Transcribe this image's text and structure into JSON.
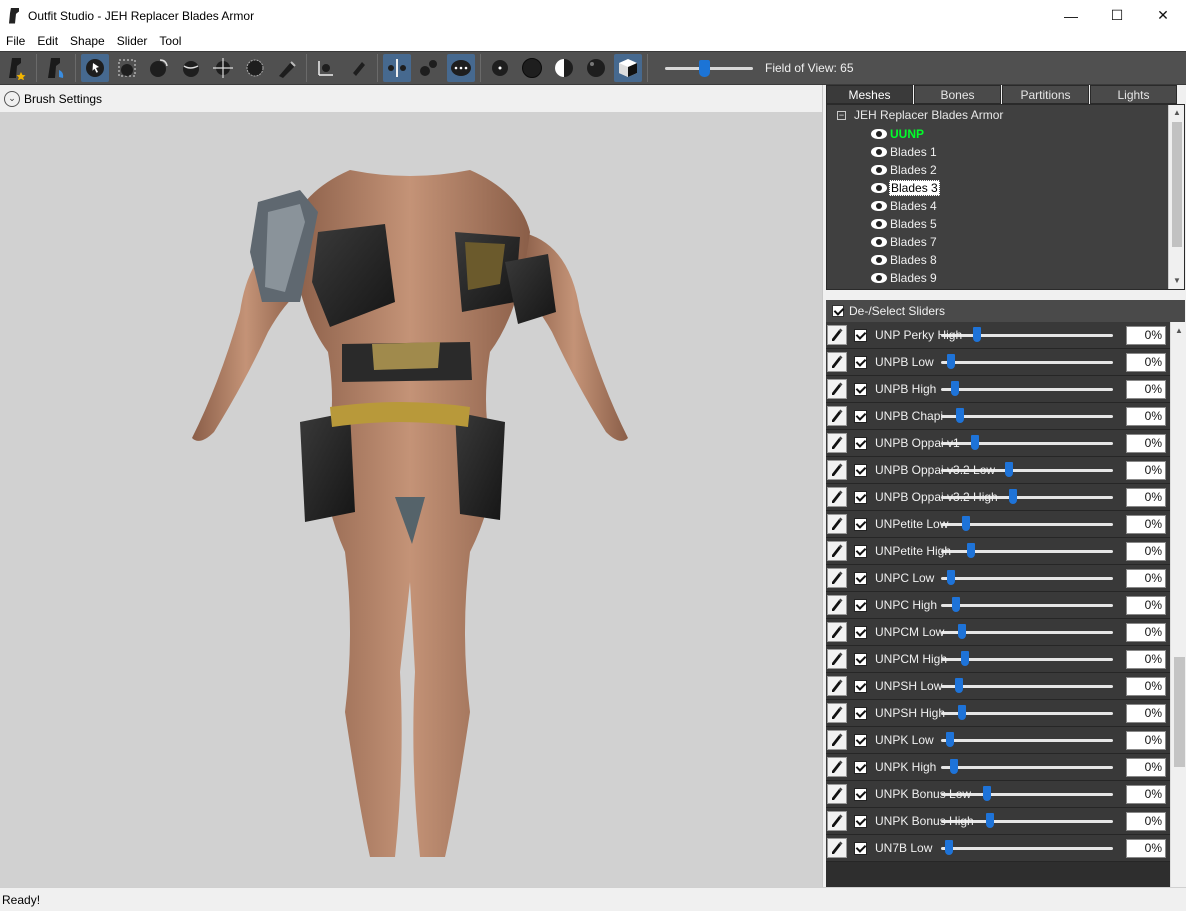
{
  "window": {
    "title": "Outfit Studio - JEH Replacer Blades Armor",
    "controls": [
      "—",
      "☐",
      "✕"
    ]
  },
  "menu": [
    "File",
    "Edit",
    "Shape",
    "Slider",
    "Tool"
  ],
  "toolbar": {
    "field_of_view_label": "Field of View: 65",
    "field_of_view_value": 65,
    "accent_color": "#1c74d6"
  },
  "brush_settings": {
    "label": "Brush Settings"
  },
  "panel": {
    "tabs": [
      "Meshes",
      "Bones",
      "Partitions",
      "Lights"
    ],
    "active_tab": "Meshes",
    "tree": {
      "root": "JEH Replacer Blades Armor",
      "items": [
        {
          "label": "UUNP",
          "reference": true
        },
        {
          "label": "Blades 1"
        },
        {
          "label": "Blades 2"
        },
        {
          "label": "Blades 3",
          "selected": true
        },
        {
          "label": "Blades 4"
        },
        {
          "label": "Blades 5"
        },
        {
          "label": "Blades 7"
        },
        {
          "label": "Blades 8"
        },
        {
          "label": "Blades 9"
        }
      ]
    },
    "slider_header": "De-/Select Sliders",
    "sliders": [
      {
        "name": "UNP Perky High",
        "level": 0.0,
        "value": "0%"
      },
      {
        "name": "UNPB Low",
        "level": 0.0,
        "value": "0%"
      },
      {
        "name": "UNPB High",
        "level": 0.0,
        "value": "0%"
      },
      {
        "name": "UNPB Chapi",
        "level": 0.0,
        "value": "0%"
      },
      {
        "name": "UNPB Oppai v1",
        "level": 0.0,
        "value": "0%"
      },
      {
        "name": "UNPB Oppai v3.2 Low",
        "level": 0.0,
        "value": "0%"
      },
      {
        "name": "UNPB Oppai v3.2 High",
        "level": 0.0,
        "value": "0%"
      },
      {
        "name": "UNPetite Low",
        "level": 0.0,
        "value": "0%"
      },
      {
        "name": "UNPetite High",
        "level": 0.0,
        "value": "0%"
      },
      {
        "name": "UNPC Low",
        "level": 0.0,
        "value": "0%"
      },
      {
        "name": "UNPC High",
        "level": 0.0,
        "value": "0%"
      },
      {
        "name": "UNPCM Low",
        "level": 0.0,
        "value": "0%"
      },
      {
        "name": "UNPCM High",
        "level": 0.0,
        "value": "0%"
      },
      {
        "name": "UNPSH Low",
        "level": 0.0,
        "value": "0%"
      },
      {
        "name": "UNPSH High",
        "level": 0.0,
        "value": "0%"
      },
      {
        "name": "UNPK Low",
        "level": 0.0,
        "value": "0%"
      },
      {
        "name": "UNPK High",
        "level": 0.0,
        "value": "0%"
      },
      {
        "name": "UNPK Bonus Low",
        "level": 0.0,
        "value": "0%"
      },
      {
        "name": "UNPK Bonus High",
        "level": 0.0,
        "value": "0%"
      },
      {
        "name": "UN7B Low",
        "level": 0.0,
        "value": "0%"
      }
    ]
  },
  "status": {
    "text": "Ready!"
  }
}
